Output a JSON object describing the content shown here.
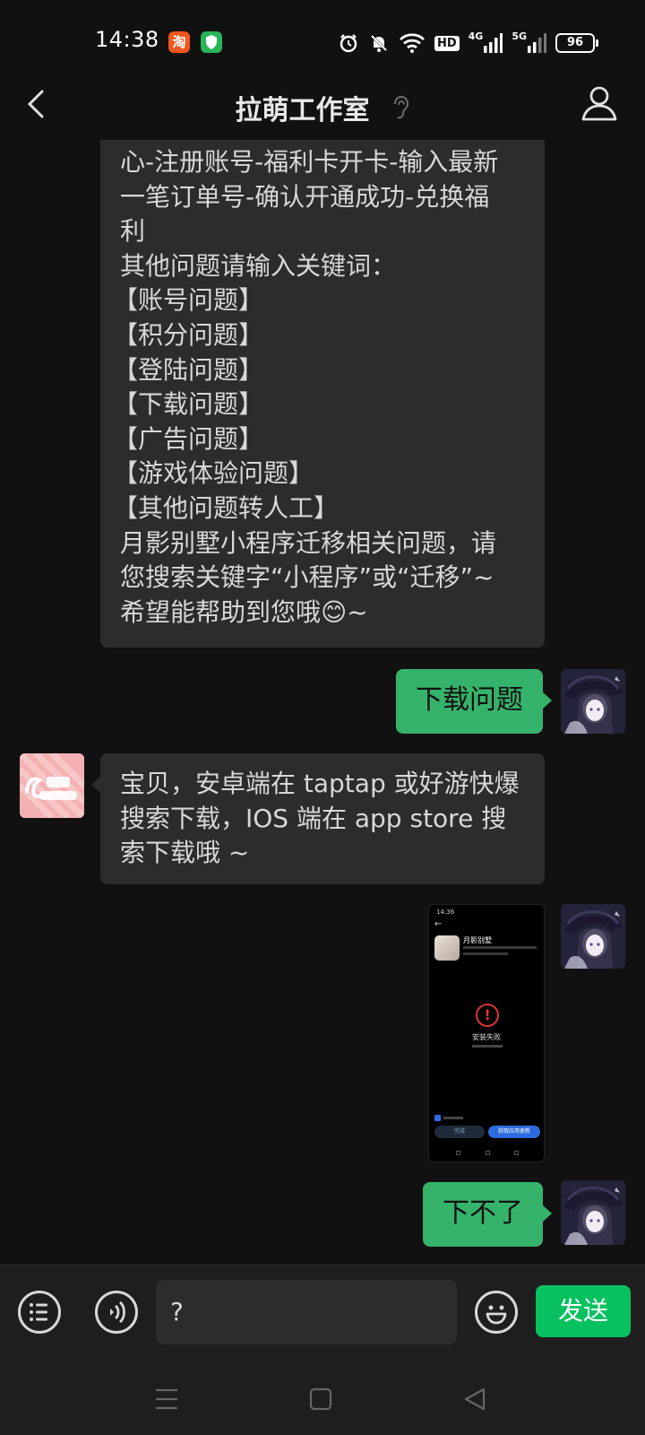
{
  "status_bar": {
    "time": "14:38",
    "app_badge_taobao": "淘",
    "battery": "96",
    "net_hd": "HD",
    "net_4g": "4G",
    "net_5g": "5G"
  },
  "header": {
    "title": "拉萌工作室"
  },
  "messages": {
    "m1_lines": [
      "心-注册账号-福利卡开卡-输入最新",
      "一笔订单号-确认开通成功-兑换福",
      "利",
      "其他问题请输入关键词：",
      "【账号问题】",
      "【积分问题】",
      "【登陆问题】",
      "【下载问题】",
      "【广告问题】",
      "【游戏体验问题】",
      "【其他问题转人工】",
      "月影别墅小程序迁移相关问题，请",
      "您搜索关键字“小程序”或“迁移”~",
      "希望能帮助到您哦😊~"
    ],
    "m2": "下载问题",
    "m3_lines": [
      "宝贝，安卓端在 taptap 或好游快爆",
      "搜索下载，IOS 端在 app store 搜",
      "索下载哦 ~"
    ],
    "m4_image": {
      "app_name": "月影别墅",
      "status": "安装失败",
      "btn_done": "完成",
      "btn_retry": "获取应用更新"
    },
    "m5": "下不了"
  },
  "input_bar": {
    "value": "?",
    "send_label": "发送"
  },
  "colors": {
    "background": "#111111",
    "incoming_bubble": "#2c2c2c",
    "outgoing_bubble": "#35b36b",
    "send_button": "#07c160"
  }
}
